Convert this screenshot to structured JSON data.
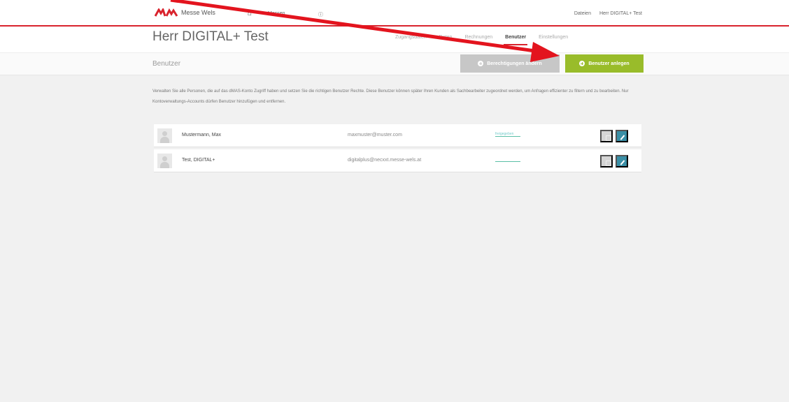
{
  "brand": {
    "name": "Messe Wels",
    "accent": "#d9232d"
  },
  "nav": {
    "home_icon": "home-icon",
    "messen": "Messen",
    "extra": "ⓘ",
    "right_items": [
      "Dateien",
      "Herr DIGITAL+ Test"
    ]
  },
  "page": {
    "title": "Herr DIGITAL+ Test",
    "tabs": [
      {
        "label": "Zugangsdaten",
        "active": false
      },
      {
        "label": "Daten",
        "active": false
      },
      {
        "label": "Rechnungen",
        "active": false
      },
      {
        "label": "Benutzer",
        "active": true
      },
      {
        "label": "Einstellungen",
        "active": false
      }
    ]
  },
  "section": {
    "title": "Benutzer",
    "btn_grey": "Berechtigungen ändern",
    "btn_add": "Benutzer anlegen",
    "add_color": "#99bc2a"
  },
  "description": "Verwalten Sie alle Personen, die auf das dMAS-Konto Zugriff haben und setzen Sie die richtigen Benutzer Rechte. Diese Benutzer können später Ihren Kunden als Sachbearbeiter zugeordnet werden, um Anfragen effizienter zu filtern und zu bearbeiten. Nur Kontoverwaltungs-Accounts dürfen Benutzer hinzufügen und entfernen.",
  "users": [
    {
      "name": "Mustermann, Max",
      "email": "maxmuster@muster.com",
      "status": "freigegeben"
    },
    {
      "name": "Test, DIGITAL+",
      "email": "digitalplus@necxxt.messe-wels.at",
      "status": ""
    }
  ],
  "annotation_color": "#e3141e"
}
